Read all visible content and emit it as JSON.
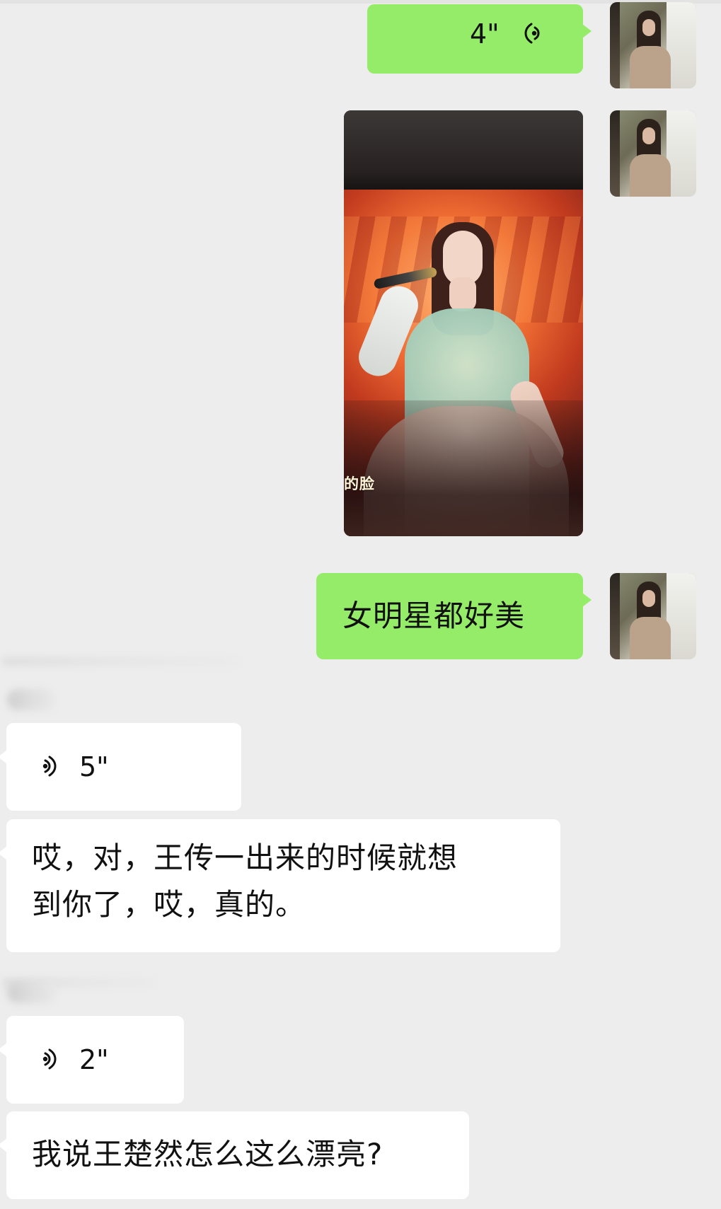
{
  "chat": {
    "messages": [
      {
        "direction": "outgoing",
        "type": "voice",
        "duration": "4\""
      },
      {
        "direction": "outgoing",
        "type": "image",
        "caption": "的脸"
      },
      {
        "direction": "outgoing",
        "type": "text",
        "text": "女明星都好美"
      },
      {
        "direction": "incoming",
        "type": "voice",
        "duration": "5\""
      },
      {
        "direction": "incoming",
        "type": "text",
        "line1": "哎，对，王传一出来的时候就想",
        "line2": "到你了，哎，真的。"
      },
      {
        "direction": "incoming",
        "type": "voice",
        "duration": "2\""
      },
      {
        "direction": "incoming",
        "type": "text",
        "text": "我说王楚然怎么这么漂亮?"
      }
    ]
  },
  "colors": {
    "background": "#ededed",
    "outgoing_bubble": "#95ec69",
    "incoming_bubble": "#ffffff",
    "text": "#111111"
  },
  "icons": {
    "outgoing_voice": "voice-wave-icon",
    "incoming_voice": "voice-wave-icon"
  }
}
